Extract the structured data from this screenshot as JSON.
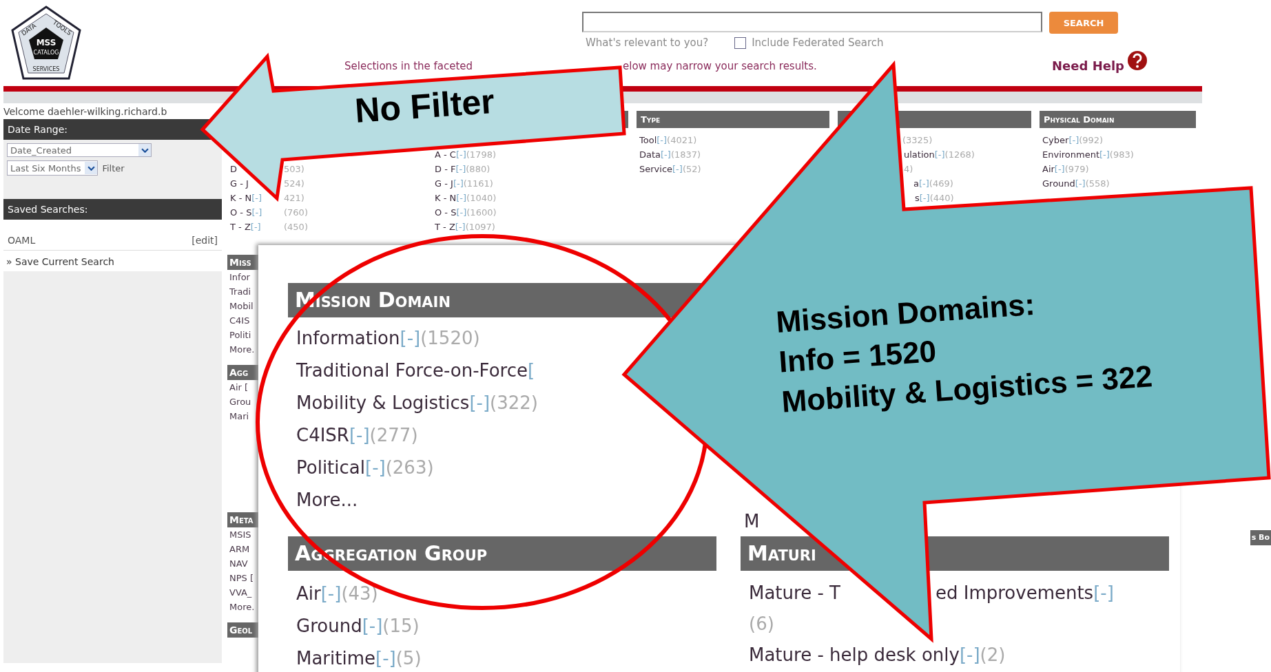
{
  "logo": {
    "top_left": "DATA",
    "top_right": "TOOLS",
    "center": "MSS",
    "center_sub": "CATALOG",
    "bottom": "SERVICES"
  },
  "header": {
    "search_button": "SEARCH",
    "search_hint": "What's relevant to you?",
    "federated": {
      "label": "Include Federated Search",
      "checked": false
    },
    "notice_left": "Selections in the faceted",
    "notice_right": "elow may narrow your search results.",
    "help": "Need Help"
  },
  "sidebar": {
    "welcome": "Velcome daehler-wilking.richard.b",
    "date_range": {
      "title": "Date Range:",
      "field": "Date_Created",
      "period": "Last Six Months",
      "filter": "Filter"
    },
    "saved": {
      "title": "Saved Searches:",
      "items": [
        {
          "name": "OAML",
          "action": "[edit]"
        }
      ],
      "save_link": "» Save Current Search"
    }
  },
  "facets_top": [
    {
      "items": [
        {
          "name": "D",
          "count": "503)"
        },
        {
          "name": "G - J",
          "count": "524)"
        },
        {
          "name": "K - N",
          "toggle": "[-]",
          "count": "421)"
        },
        {
          "name": "O - S",
          "toggle": "[-]",
          "count": "(760)"
        },
        {
          "name": "T - Z",
          "toggle": "[-]",
          "count": "(450)"
        }
      ]
    },
    {
      "items": [
        {
          "name": "A - C",
          "toggle": "[-]",
          "count": "(1798)"
        },
        {
          "name": "D - F",
          "toggle": "[-]",
          "count": "(880)"
        },
        {
          "name": "G - J",
          "toggle": "[-]",
          "count": "(1161)"
        },
        {
          "name": "K - N",
          "toggle": "[-]",
          "count": "(1040)"
        },
        {
          "name": "O - S",
          "toggle": "[-]",
          "count": "(1600)"
        },
        {
          "name": "T - Z",
          "toggle": "[-]",
          "count": "(1097)"
        }
      ]
    },
    {
      "title": "Type",
      "items": [
        {
          "name": "Tool",
          "toggle": "[-]",
          "count": "(4021)"
        },
        {
          "name": "Data",
          "toggle": "[-]",
          "count": "(1837)"
        },
        {
          "name": "Service",
          "toggle": "[-]",
          "count": "(52)"
        }
      ]
    },
    {
      "items": [
        {
          "count": "(3325)"
        },
        {
          "name": "ulation",
          "toggle": "[-]",
          "count": "(1268)"
        },
        {
          "count": "4)"
        },
        {
          "name": "a",
          "toggle": "[-]",
          "count": "(469)"
        },
        {
          "name": "s",
          "toggle": "[-]",
          "count": "(440)"
        }
      ]
    },
    {
      "title": "Physical Domain",
      "items": [
        {
          "name": "Cyber",
          "toggle": "[-]",
          "count": "(992)"
        },
        {
          "name": "Environment",
          "toggle": "[-]",
          "count": "(983)"
        },
        {
          "name": "Air",
          "toggle": "[-]",
          "count": "(979)"
        },
        {
          "name": "Ground",
          "toggle": "[-]",
          "count": "(558)"
        }
      ]
    }
  ],
  "facets_side": [
    {
      "title": "Miss",
      "items": [
        "Infor",
        "Tradi",
        "Mobil",
        "C4IS",
        "Politi",
        "More."
      ]
    },
    {
      "title": "Agg",
      "items": [
        "Air [",
        "Grou",
        "Mari"
      ]
    },
    {
      "title": "Meta",
      "items": [
        "MSIS",
        "ARM",
        "NAV",
        "NPS [",
        "VVA_",
        "More."
      ]
    },
    {
      "title": "Geol"
    }
  ],
  "side_right_header": "s Bo",
  "zoom_panel": {
    "groups": [
      {
        "title": "Mission Domain",
        "items": [
          {
            "name": "Information",
            "toggle": "[-]",
            "count": "(1520)"
          },
          {
            "name": "Traditional Force-on-Force",
            "toggle": "["
          },
          {
            "name": "Mobility & Logistics",
            "toggle": "[-]",
            "count": "(322)"
          },
          {
            "name": "C4ISR",
            "toggle": "[-]",
            "count": "(277)"
          },
          {
            "name": "Political",
            "toggle": "[-]",
            "count": "(263)"
          },
          {
            "name": "More..."
          }
        ]
      },
      {
        "title": "Aggregation Group",
        "items": [
          {
            "name": "Air",
            "toggle": "[-]",
            "count": "(43)"
          },
          {
            "name": "Ground",
            "toggle": "[-]",
            "count": "(15)"
          },
          {
            "name": "Maritime",
            "toggle": "[-]",
            "count": "(5)"
          }
        ]
      }
    ],
    "right_more": "M",
    "maturity": {
      "title": "Maturi",
      "items": [
        {
          "name": "Mature - T",
          "name_after": "ed Improvements",
          "toggle": "[-]",
          "count": "(6)"
        },
        {
          "name": "Mature - help desk only",
          "toggle": "[-]",
          "count": "(2)"
        }
      ]
    }
  },
  "callouts": [
    {
      "kind": "left-arrow",
      "lines": [
        "No Filter"
      ]
    },
    {
      "kind": "big-arrow",
      "lines": [
        "Mission Domains:",
        "Info = 1520",
        "Mobility & Logistics = 322"
      ]
    }
  ]
}
